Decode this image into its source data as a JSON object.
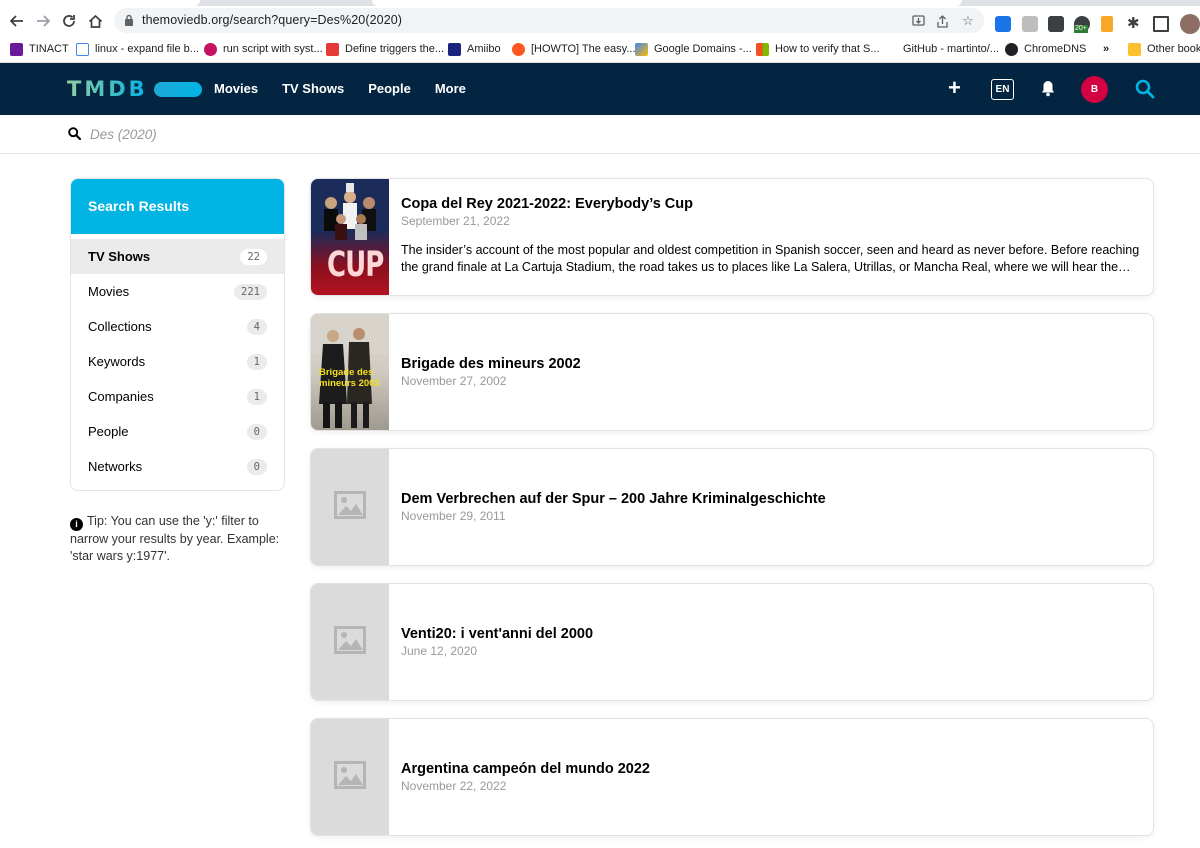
{
  "browser": {
    "url": "themoviedb.org/search?query=Des%20(2020)",
    "bookmarks": [
      {
        "label": "TINACT",
        "color": "#6a1b9a"
      },
      {
        "label": "linux - expand file b...",
        "color": "#4285f4"
      },
      {
        "label": "run script with syst...",
        "color": "#c51162"
      },
      {
        "label": "Define triggers the...",
        "color": "#e53935"
      },
      {
        "label": "Amiibo",
        "color": "#1a237e"
      },
      {
        "label": "[HOWTO] The easy...",
        "color": "#ff5722"
      },
      {
        "label": "Google Domains -...",
        "color": "#fbbc05"
      },
      {
        "label": "How to verify that S...",
        "color": "#f25022"
      },
      {
        "label": "GitHub - martinto/...",
        "color": "#ffffff"
      },
      {
        "label": "ChromeDNS",
        "color": "#202124"
      },
      {
        "label": "»",
        "color": "#ffffff"
      },
      {
        "label": "Other bookm",
        "color": "#fbc02d"
      }
    ],
    "extension_badge": "20+"
  },
  "header": {
    "logo": "TMDB",
    "nav": [
      "Movies",
      "TV Shows",
      "People",
      "More"
    ],
    "add_icon": "+",
    "language": "EN",
    "avatar_initial": "B"
  },
  "search": {
    "query": "Des (2020)",
    "placeholder": "Des (2020)"
  },
  "sidebar": {
    "title": "Search Results",
    "items": [
      {
        "label": "TV Shows",
        "count": "22",
        "active": true
      },
      {
        "label": "Movies",
        "count": "221",
        "active": false
      },
      {
        "label": "Collections",
        "count": "4",
        "active": false
      },
      {
        "label": "Keywords",
        "count": "1",
        "active": false
      },
      {
        "label": "Companies",
        "count": "1",
        "active": false
      },
      {
        "label": "People",
        "count": "0",
        "active": false
      },
      {
        "label": "Networks",
        "count": "0",
        "active": false
      }
    ]
  },
  "tip": {
    "text": "Tip: You can use the 'y:' filter to narrow your results by year. Example: 'star wars y:1977'."
  },
  "results": [
    {
      "title": "Copa del Rey 2021-2022: Everybody’s Cup",
      "date": "September 21, 2022",
      "overview": "The insider’s account of the most popular and oldest competition in Spanish soccer, seen and heard as never before. Before reaching the grand finale at La Cartuja Stadium, the road takes us to places like La Salera, Utrillas, or Mancha Real, where we will hear the stori...",
      "poster": "cup",
      "poster_text": "CUP"
    },
    {
      "title": "Brigade des mineurs 2002",
      "date": "November 27, 2002",
      "overview": "",
      "poster": "brigade",
      "poster_text": "Brigade des mineurs 2002"
    },
    {
      "title": "Dem Verbrechen auf der Spur – 200 Jahre Kriminalgeschichte",
      "date": "November 29, 2011",
      "overview": "",
      "poster": "placeholder"
    },
    {
      "title": "Venti20: i vent'anni del 2000",
      "date": "June 12, 2020",
      "overview": "",
      "poster": "placeholder"
    },
    {
      "title": "Argentina campeón del mundo 2022",
      "date": "November 22, 2022",
      "overview": "",
      "poster": "placeholder"
    }
  ],
  "colors": {
    "header_bg": "#032541",
    "accent": "#01b4e4",
    "avatar": "#d40242"
  }
}
